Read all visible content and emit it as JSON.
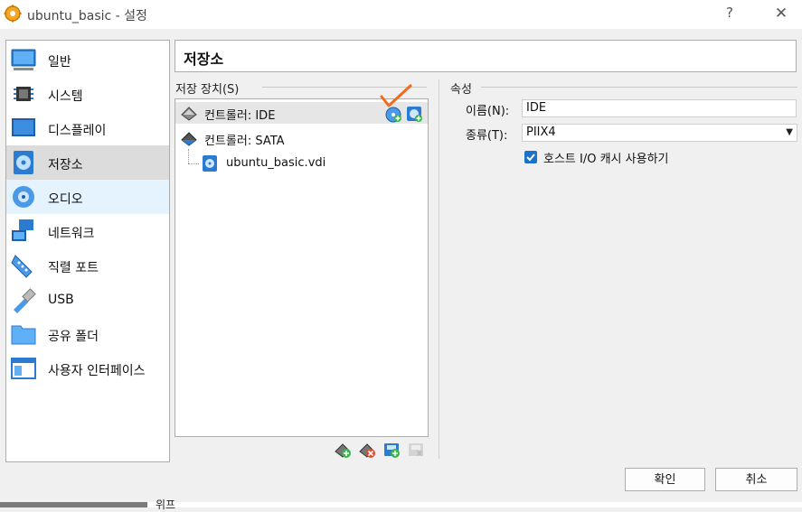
{
  "window": {
    "title": "ubuntu_basic - 설정",
    "help_glyph": "?",
    "close_glyph": "✕",
    "icon": "virtualbox-gear-icon"
  },
  "sidebar": {
    "items": [
      {
        "label": "일반",
        "icon": "general-screen-icon"
      },
      {
        "label": "시스템",
        "icon": "system-chip-icon"
      },
      {
        "label": "디스플레이",
        "icon": "display-monitor-icon"
      },
      {
        "label": "저장소",
        "icon": "storage-disk-icon",
        "selected": true
      },
      {
        "label": "오디오",
        "icon": "audio-speaker-icon",
        "hover": true
      },
      {
        "label": "네트워크",
        "icon": "network-icon"
      },
      {
        "label": "직렬 포트",
        "icon": "serial-port-icon"
      },
      {
        "label": "USB",
        "icon": "usb-icon"
      },
      {
        "label": "공유 폴더",
        "icon": "shared-folder-icon"
      },
      {
        "label": "사용자 인터페이스",
        "icon": "user-interface-icon"
      }
    ]
  },
  "section_title": "저장소",
  "storage": {
    "label": "저장 장치(S)",
    "tree": [
      {
        "label": "컨트롤러: IDE",
        "icon": "ide-controller-icon"
      },
      {
        "label": "컨트롤러: SATA",
        "icon": "sata-controller-icon"
      },
      {
        "label": "ubuntu_basic.vdi",
        "icon": "disk-image-icon"
      }
    ]
  },
  "attributes": {
    "label": "속성",
    "name_label": "이름(N):",
    "name_value": "IDE",
    "type_label": "종류(T):",
    "type_value": "PIIX4",
    "cache_label": "호스트 I/O 캐시 사용하기",
    "cache_checked": true
  },
  "buttons": {
    "ok": "확인",
    "cancel": "취소"
  },
  "background_partial_text": "위프",
  "colors": {
    "selected": "#dcdcdc",
    "hover": "#e5f3ff",
    "accent": "#1a73c8",
    "annotation": "#f26b1d"
  }
}
